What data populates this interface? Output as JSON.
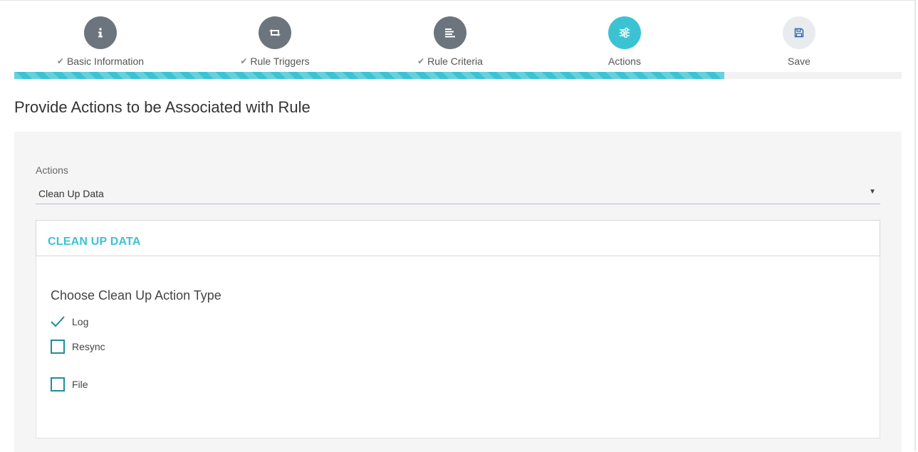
{
  "wizard": {
    "steps": [
      {
        "label": "Basic Information",
        "check": "✔",
        "icon": "info-icon"
      },
      {
        "label": "Rule Triggers",
        "check": "✔",
        "icon": "retweet-icon"
      },
      {
        "label": "Rule Criteria",
        "check": "✔",
        "icon": "align-left-icon"
      },
      {
        "label": "Actions",
        "check": "",
        "icon": "sliders-icon"
      },
      {
        "label": "Save",
        "check": "",
        "icon": "save-icon"
      }
    ],
    "progress": 0.8,
    "accent_color": "#3bc3d3"
  },
  "page": {
    "title": "Provide Actions to be Associated with Rule"
  },
  "actions_field": {
    "label": "Actions",
    "value": "Clean Up Data",
    "caret": "▼"
  },
  "cleanup_card": {
    "title": "CLEAN UP DATA",
    "section_title": "Choose Clean Up Action Type",
    "options": [
      {
        "label": "Log",
        "checked": true
      },
      {
        "label": "Resync",
        "checked": false
      },
      {
        "label": "File",
        "checked": false
      }
    ]
  }
}
